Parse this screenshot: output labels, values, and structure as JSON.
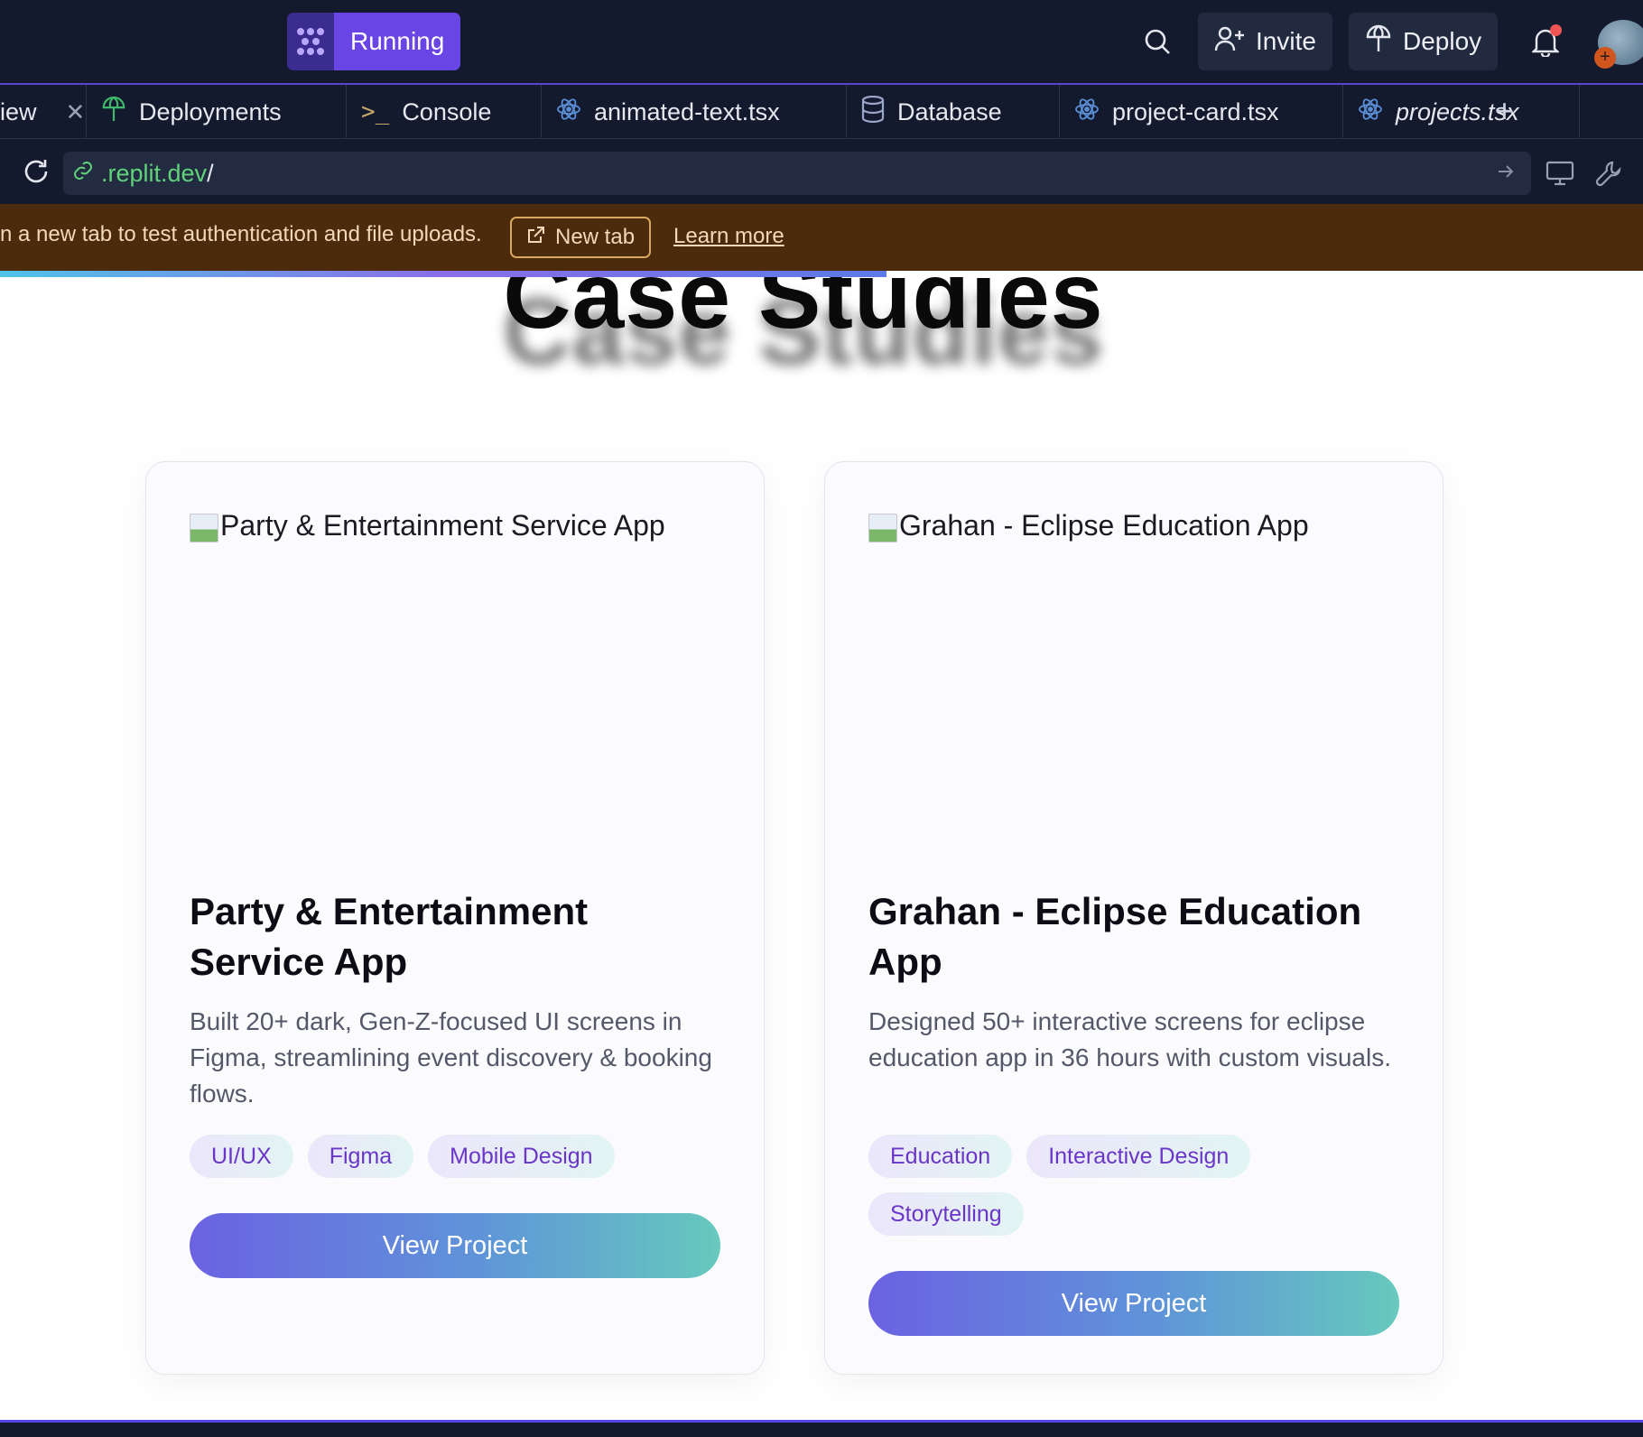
{
  "topbar": {
    "run_label": "Running",
    "invite_label": "Invite",
    "deploy_label": "Deploy"
  },
  "tabs": [
    {
      "label": "iew",
      "icon": "preview-icon"
    },
    {
      "label": "Deployments",
      "icon": "deploy-icon"
    },
    {
      "label": "Console",
      "icon": "terminal-icon"
    },
    {
      "label": "animated-text.tsx",
      "icon": "react-icon"
    },
    {
      "label": "Database",
      "icon": "database-icon"
    },
    {
      "label": "project-card.tsx",
      "icon": "react-icon"
    },
    {
      "label": "projects.tsx",
      "icon": "react-icon"
    }
  ],
  "urlbar": {
    "host": ".replit.dev",
    "path": "/"
  },
  "banner": {
    "text": "n a new tab to test authentication and file uploads.",
    "newtab_label": "New tab",
    "learn_more": "Learn more"
  },
  "page": {
    "heading": "Case Studies"
  },
  "projects": [
    {
      "image_alt": "Party & Entertainment Service App",
      "title": "Party & Entertainment Service App",
      "description": "Built 20+ dark, Gen-Z-focused UI screens in Figma, streamlining event discovery & booking flows.",
      "tags": [
        "UI/UX",
        "Figma",
        "Mobile Design"
      ],
      "button": "View Project"
    },
    {
      "image_alt": "Grahan - Eclipse Education App",
      "title": "Grahan - Eclipse Education App",
      "description": "Designed 50+ interactive screens for eclipse education app in 36 hours with custom visuals.",
      "tags": [
        "Education",
        "Interactive Design",
        "Storytelling"
      ],
      "button": "View Project"
    }
  ],
  "colors": {
    "chrome_bg": "#141a2e",
    "accent": "#6a45e6",
    "banner_bg": "#4c2a0c",
    "tag_text": "#6a36c8"
  }
}
